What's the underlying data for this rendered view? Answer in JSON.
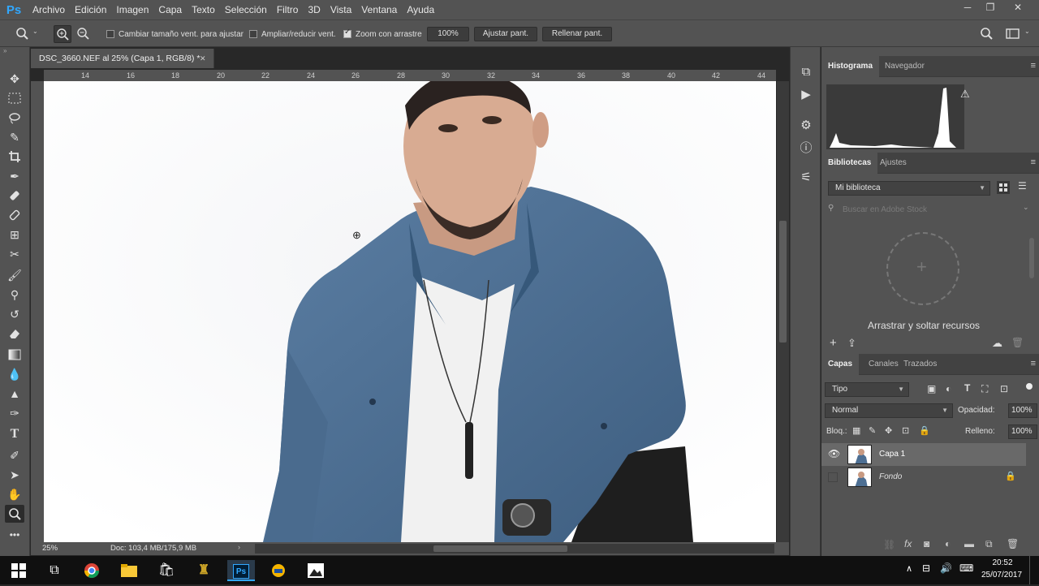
{
  "app": {
    "logo": "Ps",
    "menu": [
      "Archivo",
      "Edición",
      "Imagen",
      "Capa",
      "Texto",
      "Selección",
      "Filtro",
      "3D",
      "Vista",
      "Ventana",
      "Ayuda"
    ],
    "window_controls": [
      "─",
      "❐",
      "✕"
    ]
  },
  "options_bar": {
    "resize_windows_label": "Cambiar tamaño vent. para ajustar",
    "resize_windows_checked": false,
    "zoom_all_label": "Ampliar/reducir vent.",
    "zoom_all_checked": false,
    "scrubby_label": "Zoom con arrastre",
    "scrubby_checked": true,
    "zoom_100": "100%",
    "fit_screen": "Ajustar pant.",
    "fill_screen": "Rellenar pant."
  },
  "document": {
    "tab_title": "DSC_3660.NEF al 25% (Capa 1, RGB/8) *",
    "close": "✕",
    "ruler_ticks": [
      "14",
      "16",
      "18",
      "20",
      "22",
      "24",
      "26",
      "28",
      "30",
      "32",
      "34",
      "36",
      "38",
      "40",
      "42",
      "44"
    ],
    "zoom": "25%",
    "doc_info": "Doc: 103,4 MB/175,9 MB"
  },
  "panels": {
    "histogram": {
      "tab_active": "Histograma",
      "tab_other": "Navegador"
    },
    "libraries": {
      "tab_active": "Bibliotecas",
      "tab_other": "Ajustes",
      "library": "Mi biblioteca",
      "search_placeholder": "Buscar en Adobe Stock",
      "empty_hint": "Arrastrar y soltar recursos"
    },
    "layers": {
      "tab_active": "Capas",
      "tab_channels": "Canales",
      "tab_paths": "Trazados",
      "filter": "Tipo",
      "blend_mode": "Normal",
      "opacity_label": "Opacidad:",
      "opacity": "100%",
      "lock_label": "Bloq.:",
      "fill_label": "Relleno:",
      "fill": "100%",
      "items": [
        {
          "name": "Capa 1",
          "visible": true,
          "selected": true
        },
        {
          "name": "Fondo",
          "visible": false,
          "selected": false,
          "locked": true
        }
      ]
    }
  },
  "taskbar": {
    "time": "20:52",
    "date": "25/07/2017"
  },
  "colors": {
    "ui_panel": "#535353",
    "ui_dark": "#282828",
    "ps_blue": "#31a8ff",
    "shirt_blue": "#4d6f93"
  }
}
